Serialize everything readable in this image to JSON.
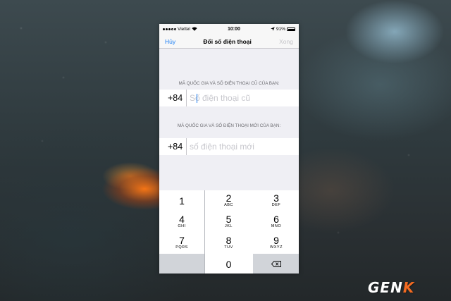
{
  "status_bar": {
    "carrier": "Viettel",
    "time": "10:00",
    "battery": "91%"
  },
  "nav": {
    "cancel": "Hủy",
    "title": "Đổi số điện thoại",
    "done": "Xong"
  },
  "old_number": {
    "section_label": "MÃ QUỐC GIA VÀ SỐ ĐIỆN THOẠI CŨ CỦA BẠN:",
    "country_code": "+84",
    "placeholder": "Số điện thoại cũ",
    "value": ""
  },
  "new_number": {
    "section_label": "MÃ QUỐC GIA VÀ SỐ ĐIỆN THOẠI MỚI CỦA BẠN:",
    "country_code": "+84",
    "placeholder": "số điện thoại mới",
    "value": ""
  },
  "keypad": {
    "keys": [
      {
        "digit": "1",
        "letters": ""
      },
      {
        "digit": "2",
        "letters": "ABC"
      },
      {
        "digit": "3",
        "letters": "DEF"
      },
      {
        "digit": "4",
        "letters": "GHI"
      },
      {
        "digit": "5",
        "letters": "JKL"
      },
      {
        "digit": "6",
        "letters": "MNO"
      },
      {
        "digit": "7",
        "letters": "PQRS"
      },
      {
        "digit": "8",
        "letters": "TUV"
      },
      {
        "digit": "9",
        "letters": "WXYZ"
      },
      {
        "digit": "0",
        "letters": ""
      }
    ],
    "delete_icon": "backspace-icon"
  },
  "watermark": {
    "prefix": "GEN",
    "suffix": "K"
  }
}
